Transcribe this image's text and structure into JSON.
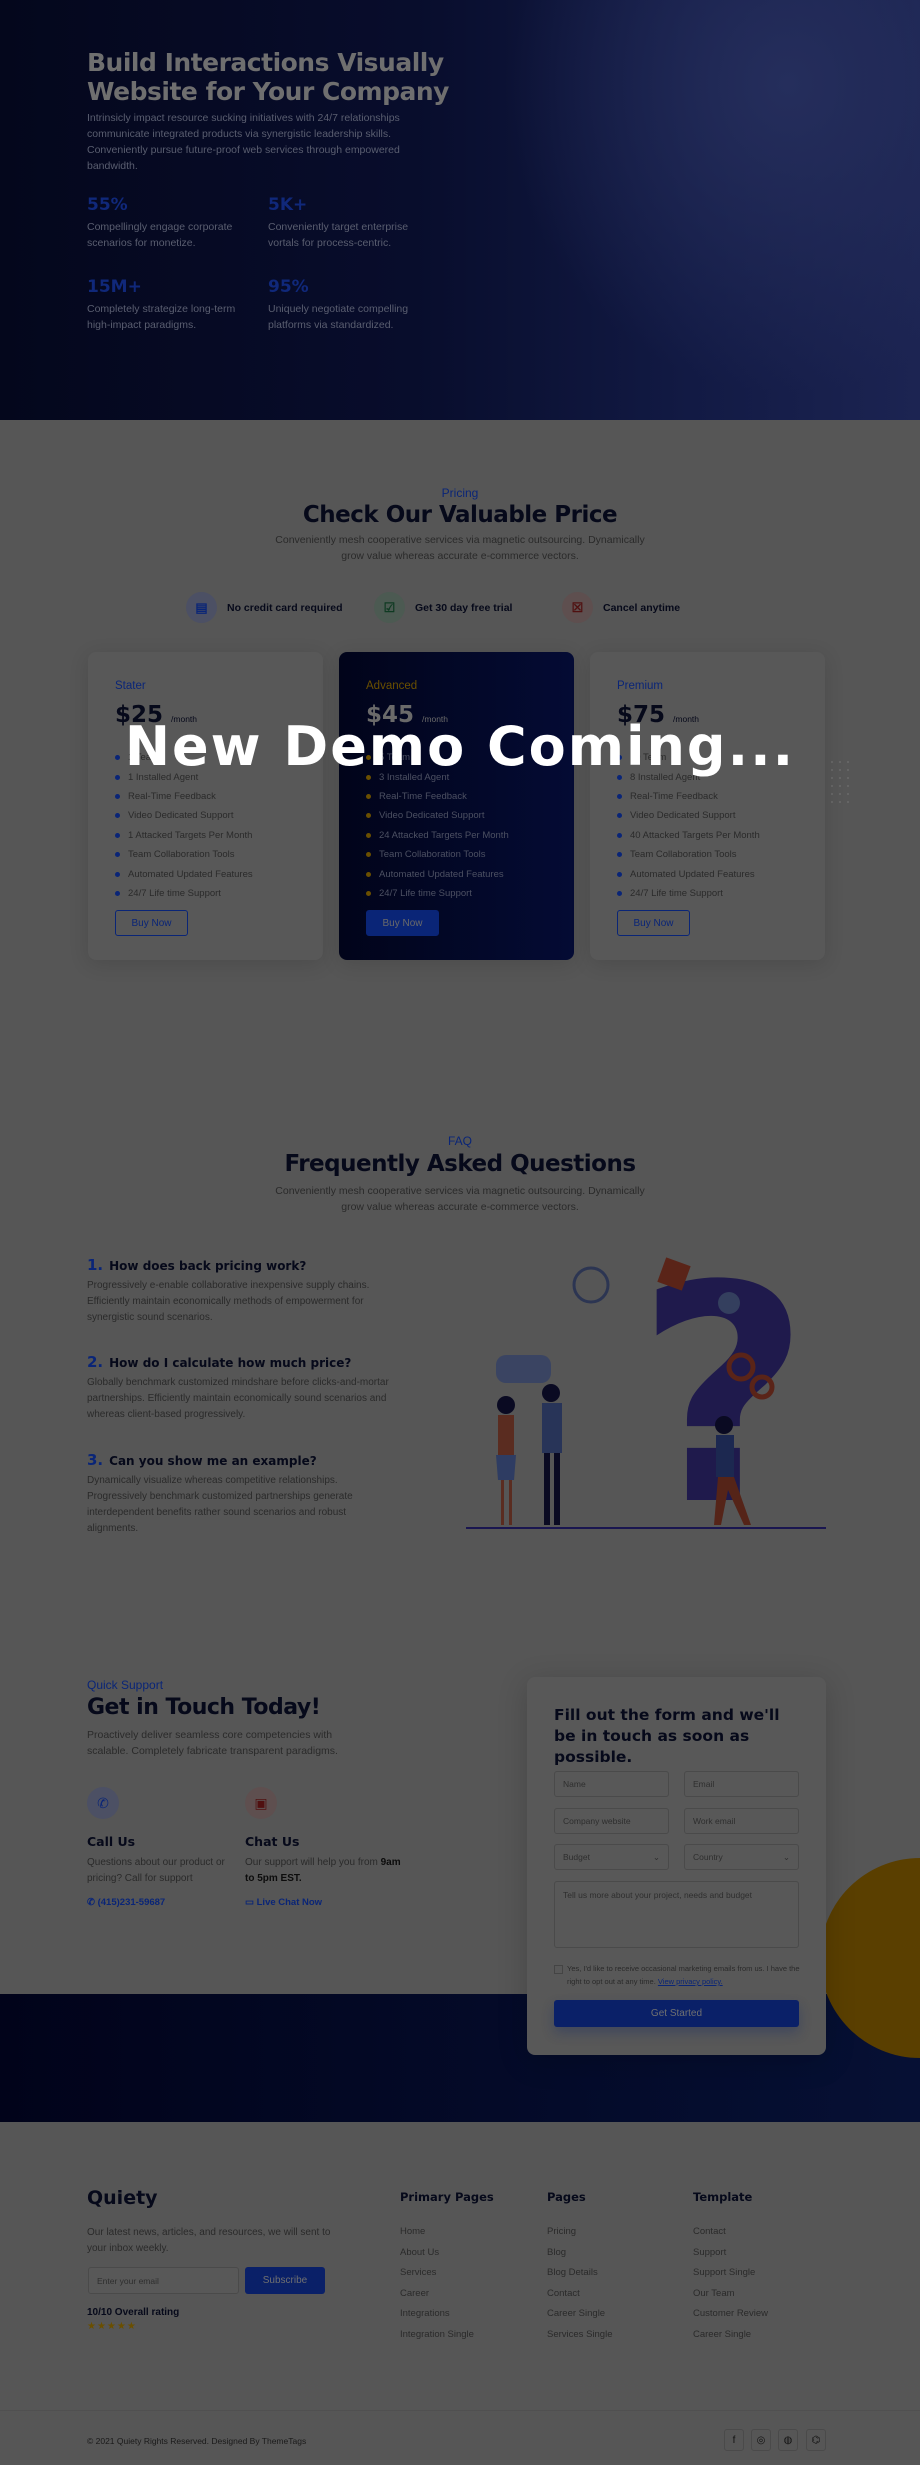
{
  "hero": {
    "title": "Build Interactions Visually Website for Your Company",
    "text": "Intrinsicly impact resource sucking initiatives with 24/7 relationships communicate integrated products via synergistic leadership skills. Conveniently pursue future-proof web services through empowered bandwidth.",
    "stats": [
      {
        "value": "55%",
        "desc": "Compellingly engage corporate scenarios for monetize."
      },
      {
        "value": "5K+",
        "desc": "Conveniently target enterprise vortals for process-centric."
      },
      {
        "value": "15M+",
        "desc": "Completely strategize long-term high-impact paradigms."
      },
      {
        "value": "95%",
        "desc": "Uniquely negotiate compelling platforms via standardized."
      }
    ]
  },
  "pricing": {
    "eyebrow": "Pricing",
    "title": "Check Our Valuable Price",
    "subtitle": "Conveniently mesh cooperative services via magnetic outsourcing. Dynamically grow value whereas accurate e-commerce vectors.",
    "features": [
      {
        "label": "No credit card required",
        "icon": "credit-card-icon"
      },
      {
        "label": "Get 30 day free trial",
        "icon": "calendar-check-icon"
      },
      {
        "label": "Cancel anytime",
        "icon": "calendar-x-icon"
      }
    ],
    "plans": [
      {
        "name": "Stater",
        "price": "$25",
        "period": "/month",
        "items": [
          "1 Team",
          "1 Installed Agent",
          "Real-Time Feedback",
          "Video Dedicated Support",
          "1 Attacked Targets Per Month",
          "Team Collaboration Tools",
          "Automated Updated Features",
          "24/7 Life time Support"
        ],
        "button": "Buy Now"
      },
      {
        "name": "Advanced",
        "price": "$45",
        "period": "/month",
        "items": [
          "5 Team",
          "3 Installed Agent",
          "Real-Time Feedback",
          "Video Dedicated Support",
          "24 Attacked Targets Per Month",
          "Team Collaboration Tools",
          "Automated Updated Features",
          "24/7 Life time Support"
        ],
        "button": "Buy Now"
      },
      {
        "name": "Premium",
        "price": "$75",
        "period": "/month",
        "items": [
          "10 Team",
          "8 Installed Agent",
          "Real-Time Feedback",
          "Video Dedicated Support",
          "40 Attacked Targets Per Month",
          "Team Collaboration Tools",
          "Automated Updated Features",
          "24/7 Life time Support"
        ],
        "button": "Buy Now"
      }
    ]
  },
  "overlay": {
    "text": "New Demo Coming..."
  },
  "faq": {
    "eyebrow": "FAQ",
    "title": "Frequently Asked Questions",
    "subtitle": "Conveniently mesh cooperative services via magnetic outsourcing. Dynamically grow value whereas accurate e-commerce vectors.",
    "items": [
      {
        "num": "1.",
        "q": "How does back pricing work?",
        "a": "Progressively e-enable collaborative inexpensive supply chains. Efficiently maintain economically methods of empowerment for synergistic sound scenarios."
      },
      {
        "num": "2.",
        "q": "How do I calculate how much price?",
        "a": "Globally benchmark customized mindshare before clicks-and-mortar partnerships. Efficiently maintain economically sound scenarios and whereas client-based progressively."
      },
      {
        "num": "3.",
        "q": "Can you show me an example?",
        "a": "Dynamically visualize whereas competitive relationships. Progressively benchmark customized partnerships generate interdependent benefits rather sound scenarios and robust alignments."
      }
    ]
  },
  "contact": {
    "eyebrow": "Quick Support",
    "title": "Get in Touch Today!",
    "text": "Proactively deliver seamless core competencies with scalable. Completely fabricate transparent paradigms.",
    "call": {
      "title": "Call Us",
      "desc": "Questions about our product or pricing? Call for support",
      "link": "(415)231-59687"
    },
    "chat": {
      "title": "Chat Us",
      "desc": "Our support will help you from",
      "hours": "9am to 5pm EST.",
      "link": "Live Chat Now"
    },
    "form": {
      "title": "Fill out the form and we'll be in touch as soon as possible.",
      "name": "Name",
      "email": "Email",
      "company": "Company website",
      "work_email": "Work email",
      "budget": "Budget",
      "country": "Country",
      "message": "Tell us more about your project, needs and budget",
      "consent": "Yes, I'd like to receive occasional marketing emails from us. I have the right to opt out at any time.",
      "privacy": "View privacy policy.",
      "submit": "Get Started"
    }
  },
  "footer": {
    "logo": "Quiety",
    "text": "Our latest news, articles, and resources, we will sent to your inbox weekly.",
    "email_placeholder": "Enter your email",
    "subscribe": "Subscribe",
    "rating": "10/10 Overall rating",
    "stars": "★★★★★",
    "columns": [
      {
        "title": "Primary Pages",
        "links": [
          "Home",
          "About Us",
          "Services",
          "Career",
          "Integrations",
          "Integration Single"
        ]
      },
      {
        "title": "Pages",
        "links": [
          "Pricing",
          "Blog",
          "Blog Details",
          "Contact",
          "Career Single",
          "Services Single"
        ]
      },
      {
        "title": "Template",
        "links": [
          "Contact",
          "Support",
          "Support Single",
          "Our Team",
          "Customer Review",
          "Career Single"
        ]
      }
    ],
    "copyright": "© 2021 Quiety Rights Reserved. Designed By ThemeTags",
    "social": [
      "f",
      "◎",
      "◍",
      "⌬"
    ]
  }
}
